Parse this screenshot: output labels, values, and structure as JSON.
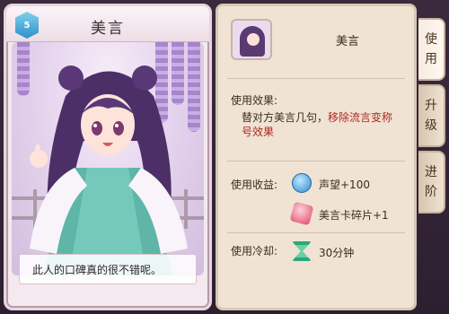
{
  "card": {
    "title": "美言",
    "badge": "5",
    "quote": "此人的口碑真的很不错呢。"
  },
  "item": {
    "name": "美言",
    "effect_label": "使用效果:",
    "effect_text_prefix": "替对方美言几句，",
    "effect_text_highlight": "移除流言变称号效果",
    "gain_label": "使用收益:",
    "gains": [
      {
        "icon": "reputation-icon",
        "text": "声望+100"
      },
      {
        "icon": "fragment-icon",
        "text": "美言卡碎片+1"
      }
    ],
    "cooldown_label": "使用冷却:",
    "cooldown_icon": "hourglass-icon",
    "cooldown_value": "30分钟"
  },
  "tabs": [
    {
      "chars": [
        "使",
        "用"
      ],
      "active": true
    },
    {
      "chars": [
        "升",
        "级"
      ],
      "active": false
    },
    {
      "chars": [
        "进",
        "阶"
      ],
      "active": false
    }
  ],
  "colors": {
    "highlight": "#b02820",
    "panel_bg": "#f0e3d3"
  }
}
